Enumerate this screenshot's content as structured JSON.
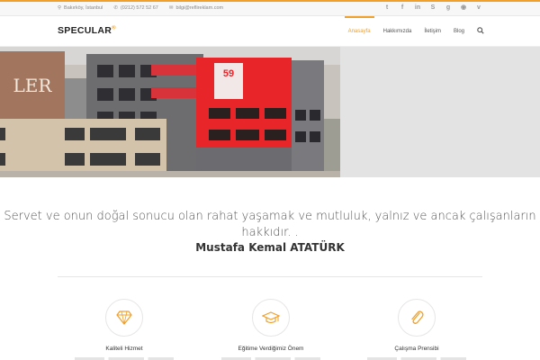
{
  "topbar": {
    "location": "Bakırköy, İstanbul",
    "phone": "(0212) 572 52 67",
    "email": "bilgi@reflireklam.com",
    "social": [
      "twitter-icon",
      "facebook-icon",
      "linkedin-icon",
      "skype-icon",
      "google-plus-icon",
      "dribbble-icon",
      "vine-icon"
    ]
  },
  "brand": {
    "name": "SPECULAR",
    "mark": "®"
  },
  "nav": {
    "items": [
      "Anasayfa",
      "Hakkımızda",
      "İletişim",
      "Blog"
    ],
    "active": "Anasayfa"
  },
  "hero": {
    "sign_number": "59",
    "side_text": "LER"
  },
  "quote": {
    "text_line1": "Servet ve onun doğal sonucu olan rahat yaşamak ve mutluluk, yalnız ve ancak çalışanların",
    "text_line2": "hakkıdır. .",
    "author": "Mustafa Kemal ATATÜRK"
  },
  "features": [
    {
      "icon": "diamond-icon",
      "title": "Kaliteli Hizmet"
    },
    {
      "icon": "graduation-cap-icon",
      "title": "Eğitime Verdiğimiz Önem"
    },
    {
      "icon": "paperclip-icon",
      "title": "Çalışma Prensibi"
    }
  ],
  "colors": {
    "accent": "#f1a02a",
    "building_red": "#e8262a"
  }
}
